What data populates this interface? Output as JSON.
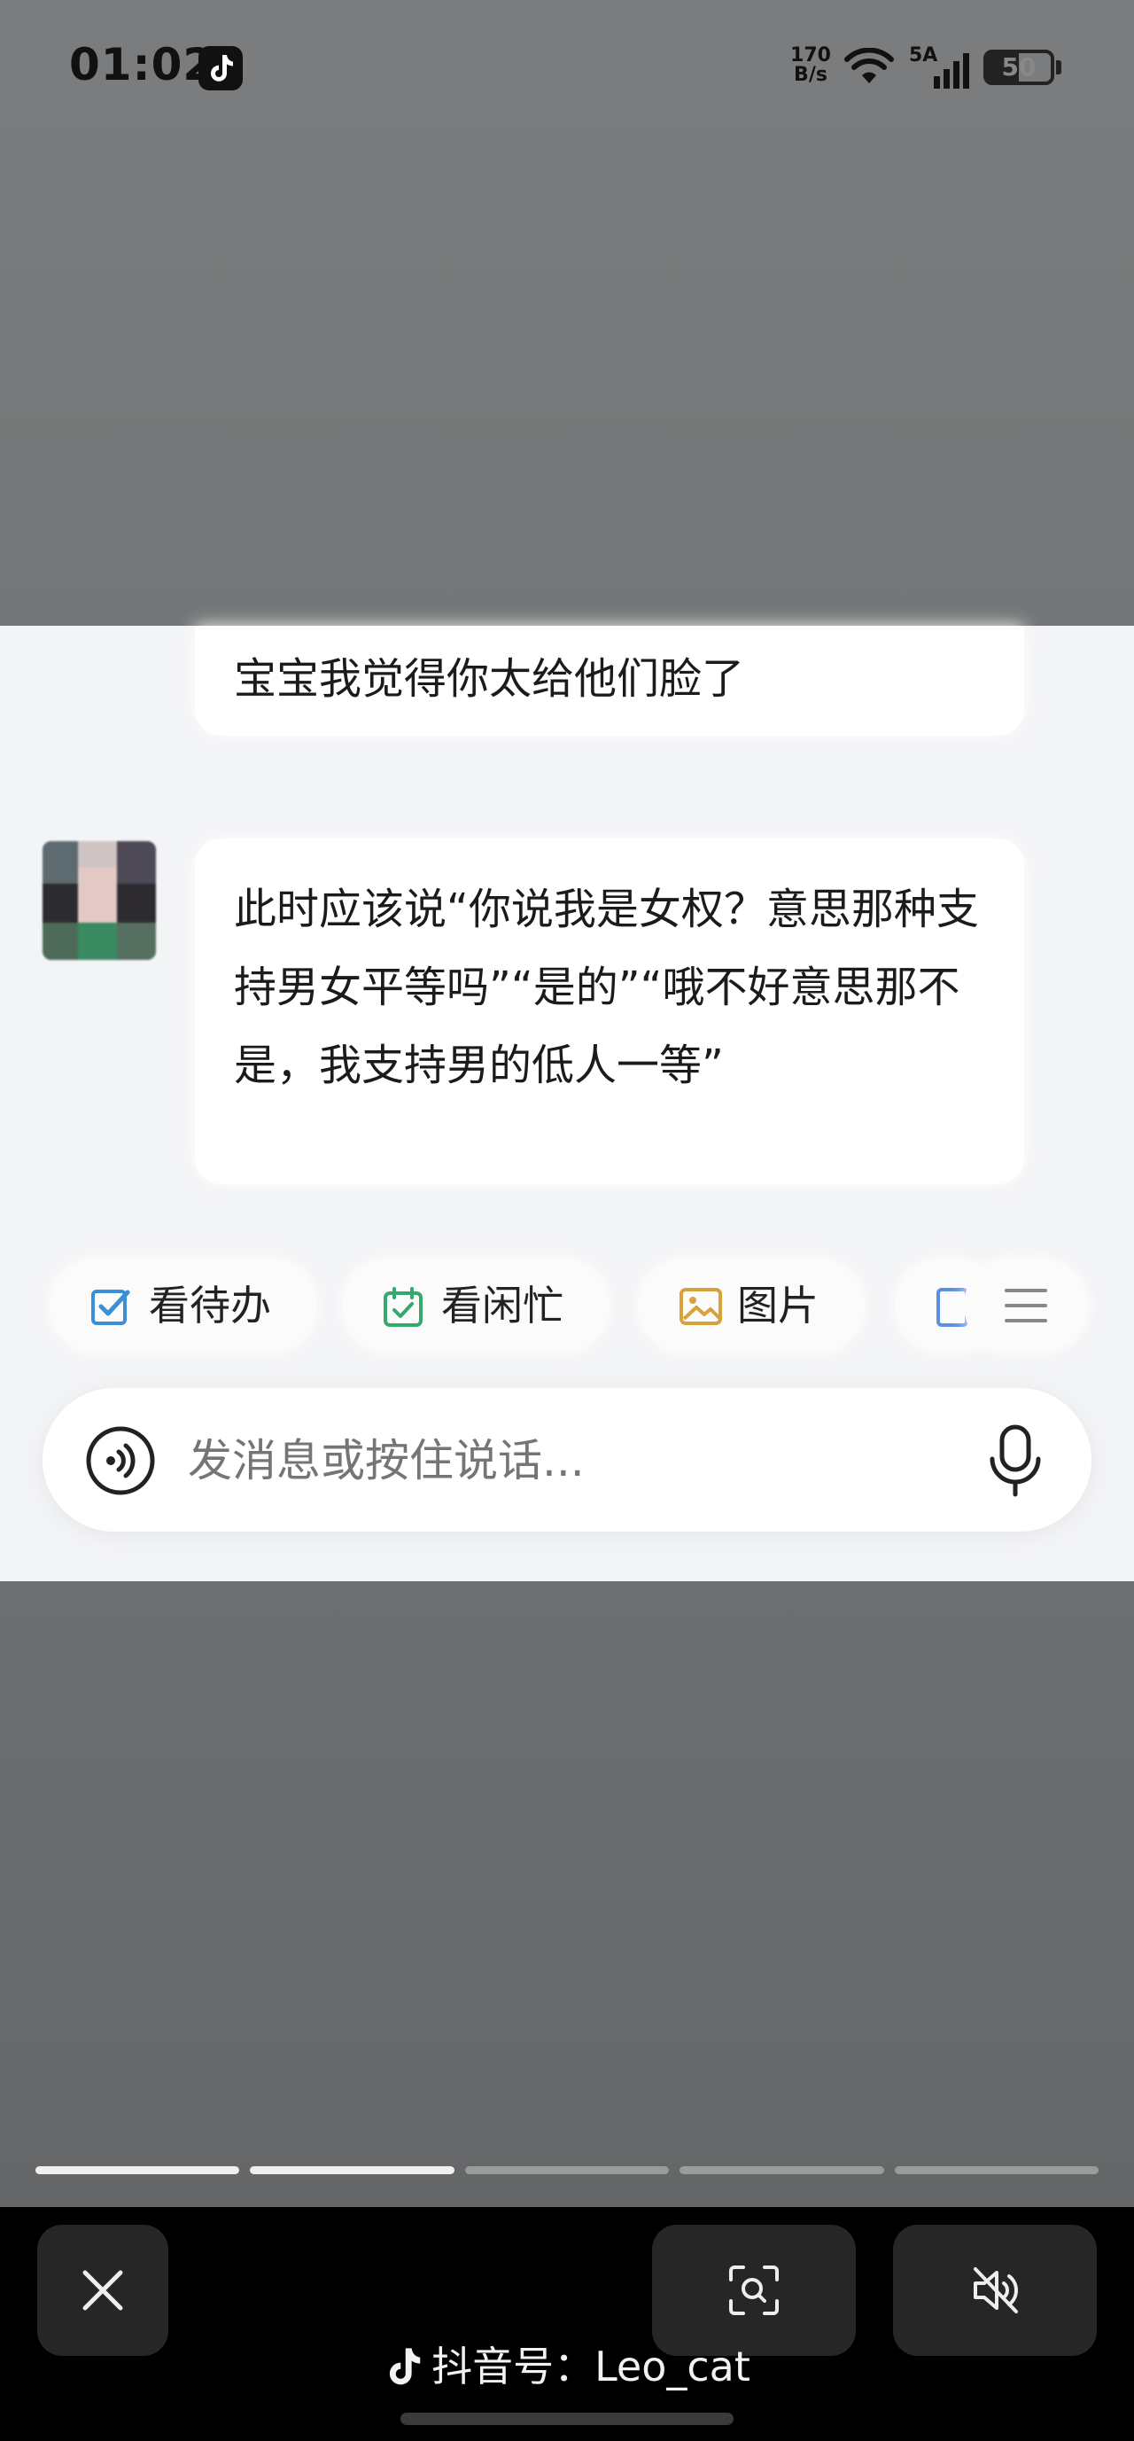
{
  "status_bar": {
    "time": "01:02",
    "app_icon": "tiktok-note-icon",
    "net_speed_value": "170",
    "net_speed_unit": "B/s",
    "signal_label": "5A",
    "battery_level": "50",
    "battery_fraction": 0.5
  },
  "chat": {
    "messages": [
      {
        "text": "宝宝我觉得你太给他们脸了"
      },
      {
        "text": "此时应该说“你说我是女权？意思那种支持男女平等吗”“是的”“哦不好意思那不是，我支持男的低人一等”"
      }
    ],
    "quick_actions": [
      {
        "label": "看待办",
        "icon": "checkbox-icon",
        "color": "#3b8fd6"
      },
      {
        "label": "看闲忙",
        "icon": "calendar-check-icon",
        "color": "#35a86b"
      },
      {
        "label": "图片",
        "icon": "image-icon",
        "color": "#d8a23a"
      },
      {
        "label": "",
        "icon": "document-icon",
        "color": "#5b8fe0"
      }
    ],
    "more_icon": "menu-icon",
    "input": {
      "placeholder": "发消息或按住说话..."
    }
  },
  "story_progress": {
    "segments": 5,
    "completed": 2
  },
  "bottom_bar": {
    "account_label": "抖音号：Leo_cat"
  }
}
